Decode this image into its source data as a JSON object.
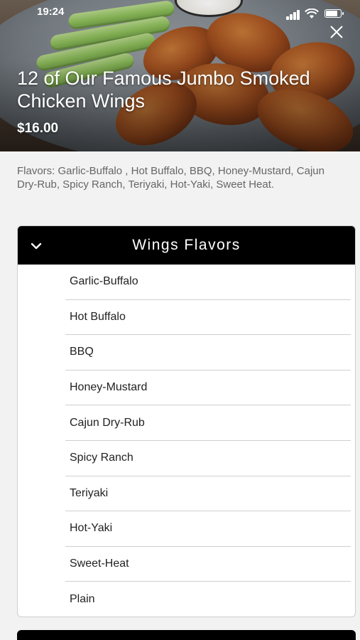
{
  "status_bar": {
    "time": "19:24"
  },
  "item": {
    "title": "12 of Our Famous Jumbo Smoked Chicken Wings",
    "price": "$16.00",
    "description": "Flavors: Garlic-Buffalo , Hot Buffalo, BBQ, Honey-Mustard, Cajun Dry-Rub, Spicy Ranch, Teriyaki, Hot-Yaki, Sweet Heat."
  },
  "flavor_panel": {
    "title": "Wings Flavors",
    "options": [
      {
        "label": "Garlic-Buffalo"
      },
      {
        "label": "Hot Buffalo"
      },
      {
        "label": "BBQ"
      },
      {
        "label": "Honey-Mustard"
      },
      {
        "label": "Cajun Dry-Rub"
      },
      {
        "label": "Spicy Ranch"
      },
      {
        "label": "Teriyaki"
      },
      {
        "label": "Hot-Yaki"
      },
      {
        "label": "Sweet-Heat"
      },
      {
        "label": "Plain"
      }
    ]
  },
  "icons": {
    "close": "close-icon",
    "collapse": "chevron-down-icon",
    "wifi": "wifi-icon",
    "battery": "battery-icon",
    "signal": "signal-icon"
  },
  "colors": {
    "panel_header": "#000000",
    "description_text": "#666666",
    "background": "#f2f2f2"
  }
}
